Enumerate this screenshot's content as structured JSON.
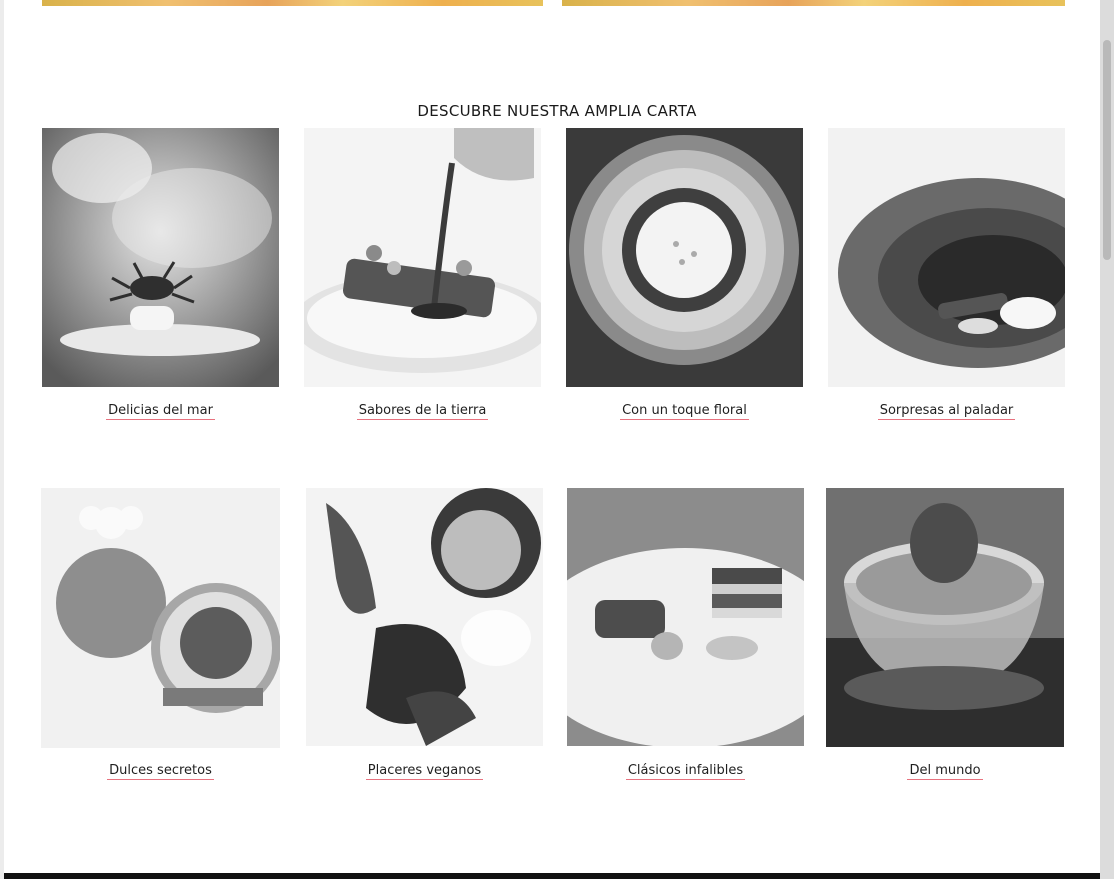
{
  "section": {
    "title": "DESCUBRE NUESTRA AMPLIA CARTA"
  },
  "categories": [
    {
      "label": "Delicias del mar"
    },
    {
      "label": "Sabores de la tierra"
    },
    {
      "label": "Con un toque floral"
    },
    {
      "label": "Sorpresas al paladar"
    },
    {
      "label": "Dulces secretos"
    },
    {
      "label": "Placeres veganos"
    },
    {
      "label": "Clásicos infalibles"
    },
    {
      "label": "Del mundo"
    }
  ],
  "colors": {
    "link_underline": "#e8727f",
    "footer": "#111111"
  }
}
